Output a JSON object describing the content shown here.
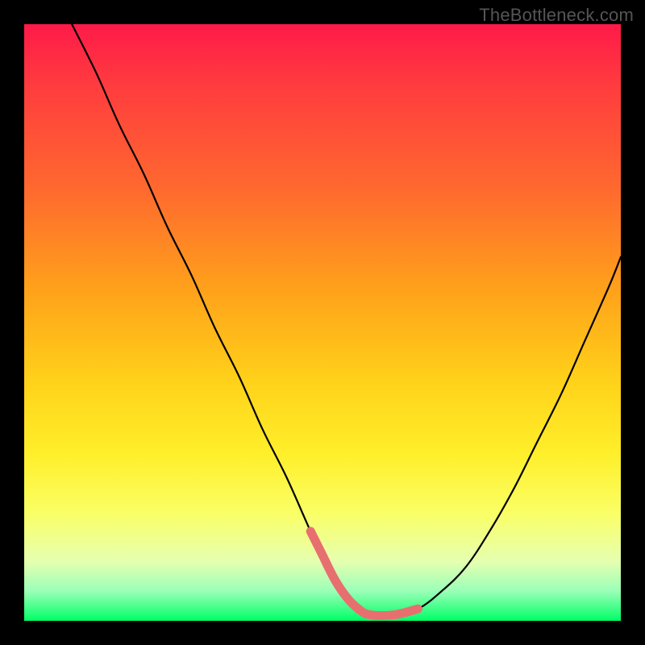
{
  "watermark": "TheBottleneck.com",
  "colors": {
    "frame": "#000000",
    "curve": "#000000",
    "trough_marker": "#e86f6f",
    "gradient_stops": [
      "#ff1a49",
      "#ff3b3f",
      "#ff6a2e",
      "#ffa31a",
      "#ffd21a",
      "#ffef2a",
      "#faff66",
      "#e6ffb0",
      "#9bffb8",
      "#00ff66"
    ]
  },
  "chart_data": {
    "type": "line",
    "title": "",
    "xlabel": "",
    "ylabel": "",
    "xlim": [
      0,
      100
    ],
    "ylim": [
      0,
      100
    ],
    "legend": false,
    "grid": false,
    "series": [
      {
        "name": "bottleneck-curve",
        "x": [
          8,
          12,
          16,
          20,
          24,
          28,
          32,
          36,
          40,
          44,
          48,
          50,
          52,
          54,
          56,
          58,
          62,
          66,
          70,
          74,
          78,
          82,
          86,
          90,
          94,
          98,
          100
        ],
        "values": [
          100,
          92,
          83,
          75,
          66,
          58,
          49,
          41,
          32,
          24,
          15,
          11,
          7,
          4,
          2,
          1,
          1,
          2,
          5,
          9,
          15,
          22,
          30,
          38,
          47,
          56,
          61
        ]
      }
    ],
    "annotations": [
      {
        "name": "optimal-range-marker",
        "x_range": [
          48,
          66
        ],
        "y": 1,
        "color": "#e86f6f"
      }
    ]
  }
}
